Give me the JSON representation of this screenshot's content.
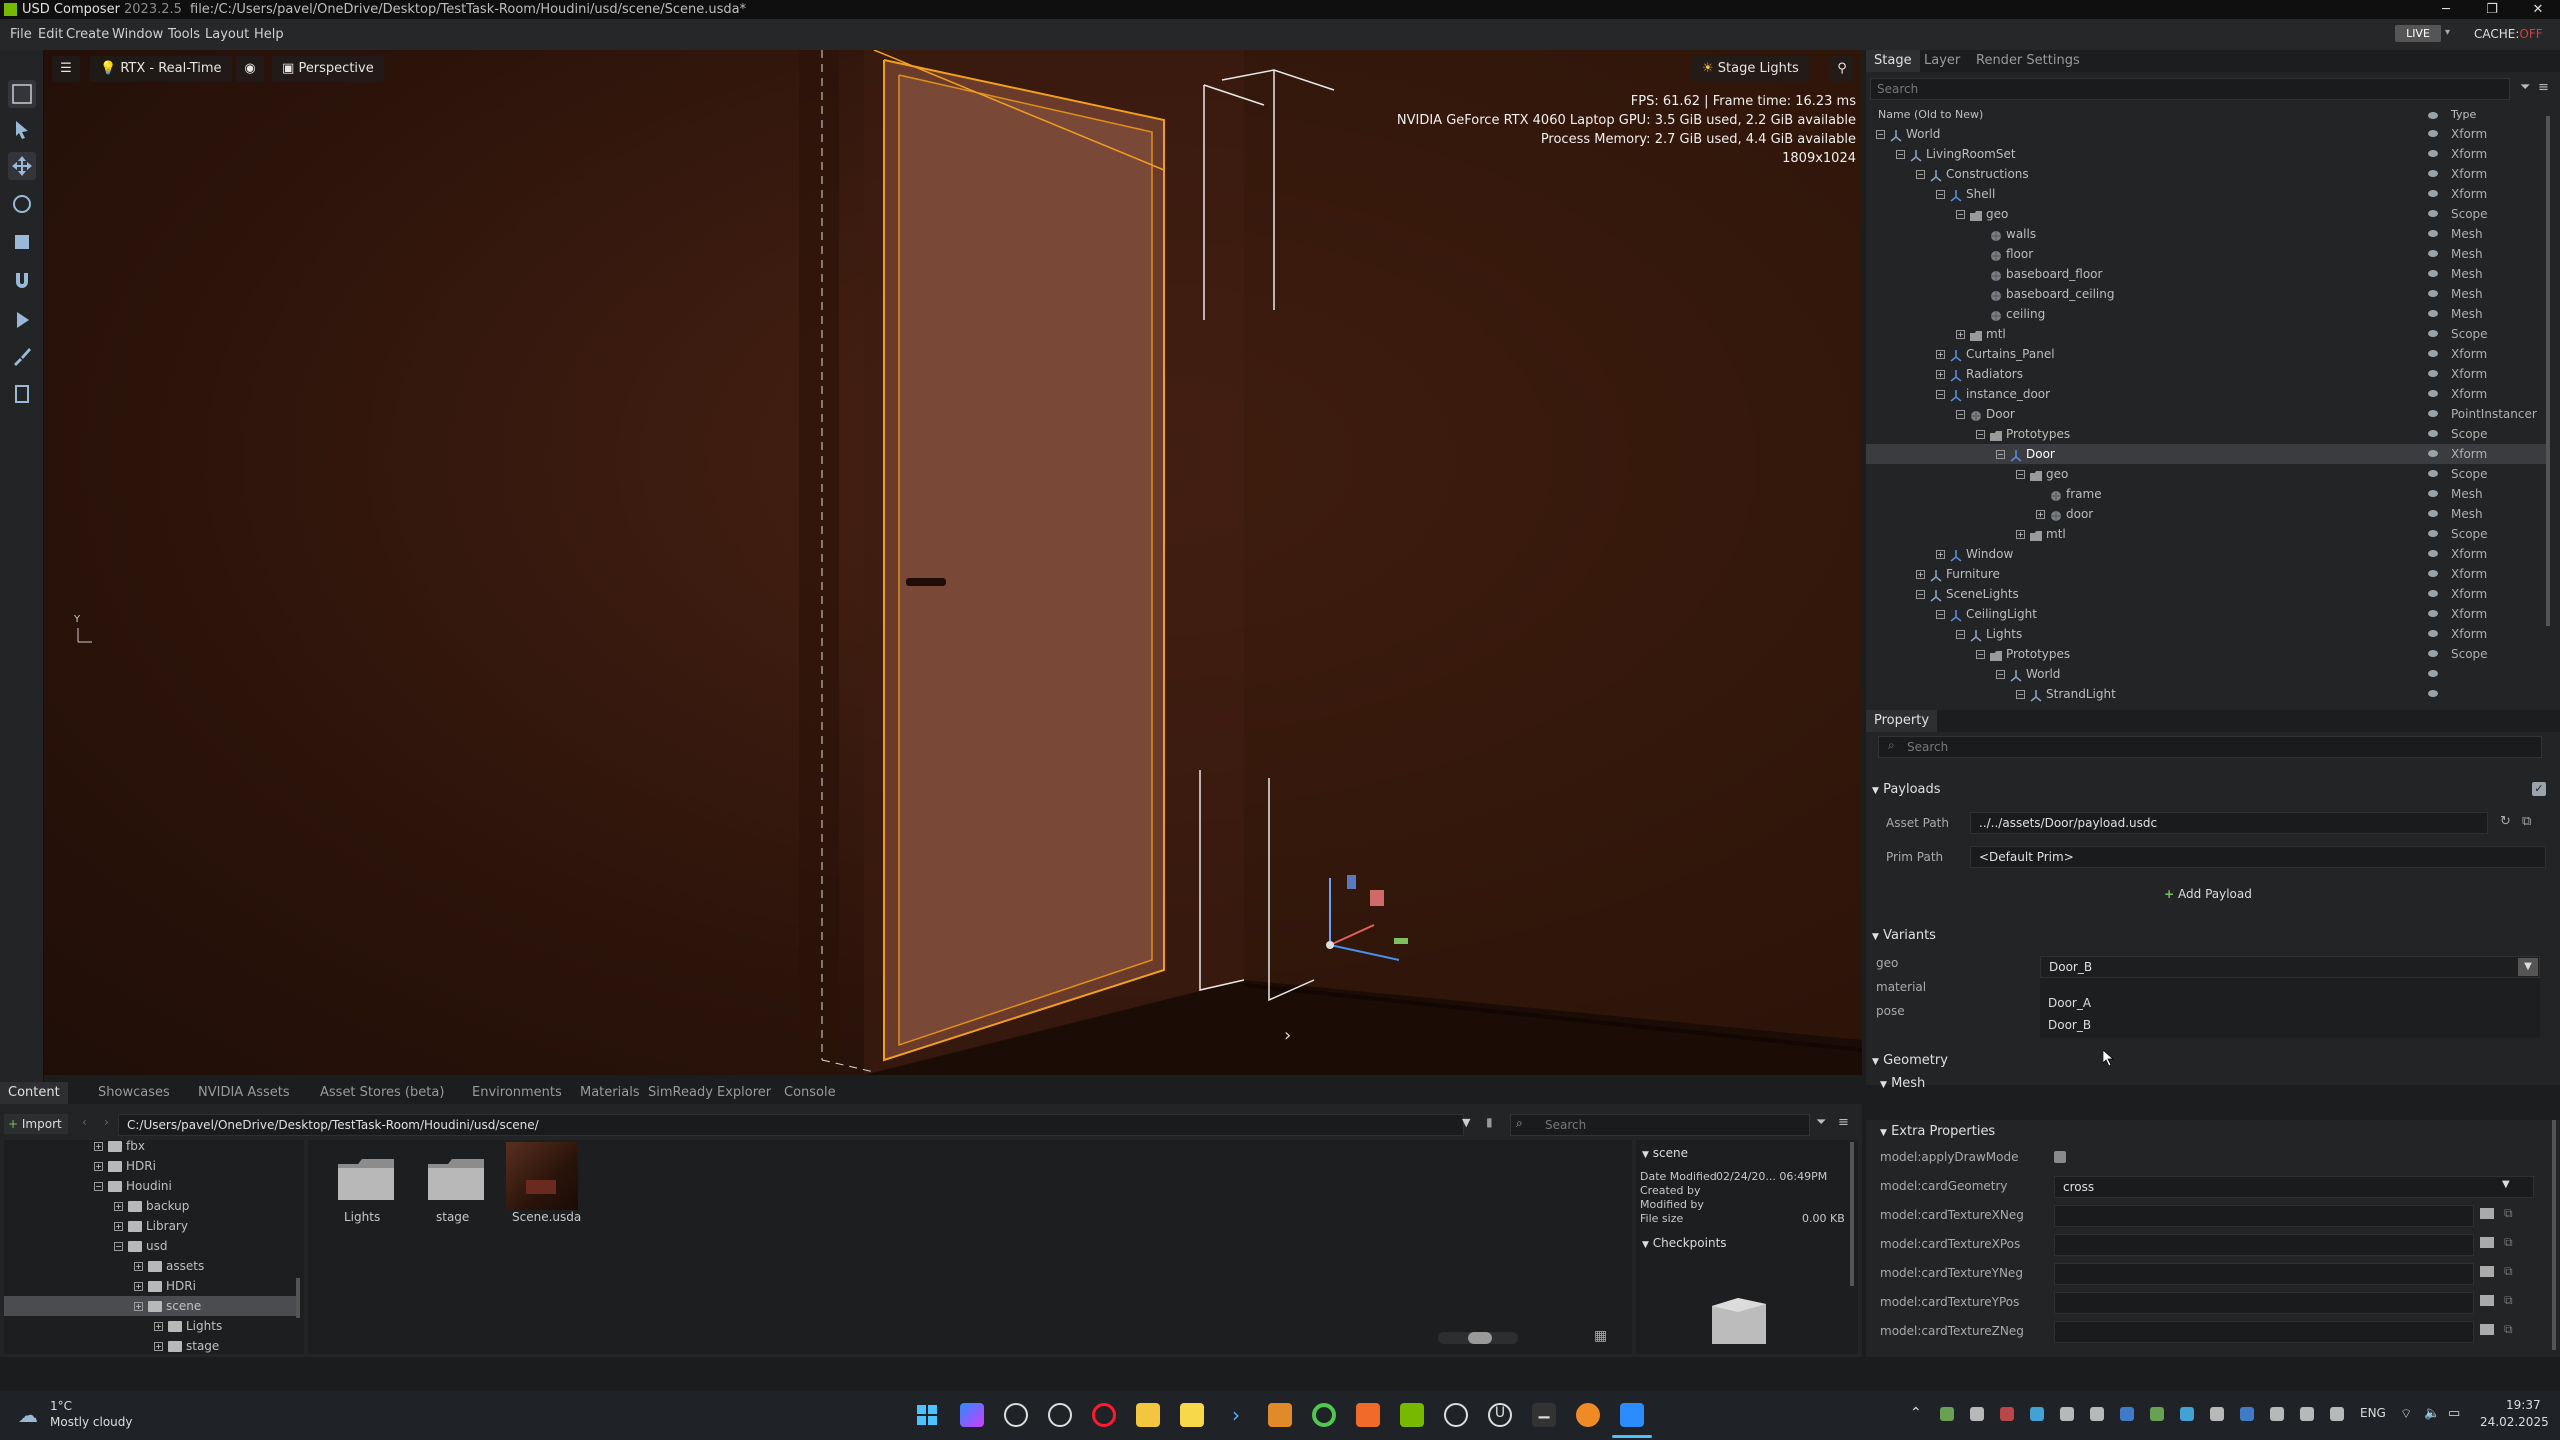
{
  "window": {
    "app_name": "USD Composer",
    "version": "2023.2.5",
    "title": "file:/C:/Users/pavel/OneDrive/Desktop/TestTask-Room/Houdini/usd/scene/Scene.usda*",
    "minimize": "─",
    "maximize": "❐",
    "close": "✕"
  },
  "menu": [
    "File",
    "Edit",
    "Create",
    "Window",
    "Tools",
    "Layout",
    "Help"
  ],
  "menu_right": {
    "live": "LIVE",
    "cache_label": "CACHE:",
    "cache_state": "OFF"
  },
  "viewport": {
    "renderer": "RTX - Real-Time",
    "camera": "Perspective",
    "stage_lights": "Stage Lights",
    "stats": [
      "FPS: 61.62 | Frame time: 16.23 ms",
      "NVIDIA GeForce RTX 4060 Laptop GPU: 3.5 GiB used, 2.2 GiB available",
      "Process Memory: 2.7 GiB used, 4.4 GiB available",
      "1809x1024"
    ],
    "axis_label": "Y"
  },
  "stage": {
    "tabs": [
      "Stage",
      "Layer",
      "Render Settings"
    ],
    "search_placeholder": "Search",
    "col_name": "Name (Old to New)",
    "col_type": "Type",
    "rows": [
      {
        "name": "World",
        "type": "Xform",
        "depth": 0,
        "icon": "xform",
        "exp": "-"
      },
      {
        "name": "LivingRoomSet",
        "type": "Xform",
        "depth": 1,
        "icon": "xform",
        "exp": "-"
      },
      {
        "name": "Constructions",
        "type": "Xform",
        "depth": 2,
        "icon": "xform",
        "exp": "-"
      },
      {
        "name": "Shell",
        "type": "Xform",
        "depth": 3,
        "icon": "xformblue",
        "exp": "-"
      },
      {
        "name": "geo",
        "type": "Scope",
        "depth": 4,
        "icon": "folder",
        "exp": "-"
      },
      {
        "name": "walls",
        "type": "Mesh",
        "depth": 5,
        "icon": "mesh",
        "exp": ""
      },
      {
        "name": "floor",
        "type": "Mesh",
        "depth": 5,
        "icon": "mesh",
        "exp": ""
      },
      {
        "name": "baseboard_floor",
        "type": "Mesh",
        "depth": 5,
        "icon": "mesh",
        "exp": ""
      },
      {
        "name": "baseboard_ceiling",
        "type": "Mesh",
        "depth": 5,
        "icon": "mesh",
        "exp": ""
      },
      {
        "name": "ceiling",
        "type": "Mesh",
        "depth": 5,
        "icon": "mesh",
        "exp": ""
      },
      {
        "name": "mtl",
        "type": "Scope",
        "depth": 4,
        "icon": "folder",
        "exp": "+"
      },
      {
        "name": "Curtains_Panel",
        "type": "Xform",
        "depth": 3,
        "icon": "xformblue",
        "exp": "+"
      },
      {
        "name": "Radiators",
        "type": "Xform",
        "depth": 3,
        "icon": "xformblue",
        "exp": "+"
      },
      {
        "name": "instance_door",
        "type": "Xform",
        "depth": 3,
        "icon": "xformblue",
        "exp": "-"
      },
      {
        "name": "Door",
        "type": "PointInstancer",
        "depth": 4,
        "icon": "mesh",
        "exp": "-"
      },
      {
        "name": "Prototypes",
        "type": "Scope",
        "depth": 5,
        "icon": "folder",
        "exp": "-"
      },
      {
        "name": "Door",
        "type": "Xform",
        "depth": 6,
        "icon": "xformblue",
        "exp": "-",
        "sel": true
      },
      {
        "name": "geo",
        "type": "Scope",
        "depth": 7,
        "icon": "folder",
        "exp": "-"
      },
      {
        "name": "frame",
        "type": "Mesh",
        "depth": 8,
        "icon": "mesh",
        "exp": ""
      },
      {
        "name": "door",
        "type": "Mesh",
        "depth": 8,
        "icon": "mesh",
        "exp": "+"
      },
      {
        "name": "mtl",
        "type": "Scope",
        "depth": 7,
        "icon": "folder",
        "exp": "+"
      },
      {
        "name": "Window",
        "type": "Xform",
        "depth": 3,
        "icon": "xformblue",
        "exp": "+"
      },
      {
        "name": "Furniture",
        "type": "Xform",
        "depth": 2,
        "icon": "xform",
        "exp": "+"
      },
      {
        "name": "SceneLights",
        "type": "Xform",
        "depth": 2,
        "icon": "xform",
        "exp": "-"
      },
      {
        "name": "CeilingLight",
        "type": "Xform",
        "depth": 3,
        "icon": "xformblue",
        "exp": "-"
      },
      {
        "name": "Lights",
        "type": "Xform",
        "depth": 4,
        "icon": "xform",
        "exp": "-"
      },
      {
        "name": "Prototypes",
        "type": "Scope",
        "depth": 5,
        "icon": "folder",
        "exp": "-"
      },
      {
        "name": "World",
        "type": "",
        "depth": 6,
        "icon": "xform",
        "exp": "-"
      },
      {
        "name": "StrandLight",
        "type": "",
        "depth": 7,
        "icon": "xform",
        "exp": "-"
      }
    ]
  },
  "property": {
    "tab": "Property",
    "search_placeholder": "Search",
    "payloads": {
      "title": "Payloads",
      "asset_path_label": "Asset Path",
      "asset_path": "../../assets/Door/payload.usdc",
      "prim_path_label": "Prim Path",
      "prim_path": "<Default Prim>",
      "add_payload": "Add Payload"
    },
    "variants": {
      "title": "Variants",
      "labels": [
        "geo",
        "material",
        "pose"
      ],
      "geo_value": "Door_B",
      "dropdown_options": [
        "Door_A",
        "Door_B"
      ]
    },
    "geometry": {
      "title": "Geometry",
      "mesh": "Mesh",
      "extra": "Extra Properties"
    },
    "extra_props": [
      {
        "label": "model:applyDrawMode",
        "kind": "checkbox"
      },
      {
        "label": "model:cardGeometry",
        "kind": "select",
        "value": "cross"
      },
      {
        "label": "model:cardTextureXNeg",
        "kind": "path"
      },
      {
        "label": "model:cardTextureXPos",
        "kind": "path"
      },
      {
        "label": "model:cardTextureYNeg",
        "kind": "path"
      },
      {
        "label": "model:cardTextureYPos",
        "kind": "path"
      },
      {
        "label": "model:cardTextureZNeg",
        "kind": "path"
      }
    ]
  },
  "content": {
    "tabs": [
      "Content",
      "Showcases",
      "NVIDIA Assets",
      "Asset Stores (beta)",
      "Environments",
      "Materials",
      "SimReady Explorer",
      "Console"
    ],
    "import": "Import",
    "path": "C:/Users/pavel/OneDrive/Desktop/TestTask-Room/Houdini/usd/scene/",
    "search_placeholder": "Search",
    "tree": [
      {
        "name": "fbx",
        "depth": 0
      },
      {
        "name": "HDRi",
        "depth": 0
      },
      {
        "name": "Houdini",
        "depth": 0,
        "exp": "-"
      },
      {
        "name": "backup",
        "depth": 1
      },
      {
        "name": "Library",
        "depth": 1
      },
      {
        "name": "usd",
        "depth": 1,
        "exp": "-"
      },
      {
        "name": "assets",
        "depth": 2
      },
      {
        "name": "HDRi",
        "depth": 2
      },
      {
        "name": "scene",
        "depth": 2,
        "sel": true
      },
      {
        "name": "Lights",
        "depth": 3
      },
      {
        "name": "stage",
        "depth": 3
      }
    ],
    "files": [
      "Lights",
      "stage",
      "Scene.usda"
    ],
    "info": {
      "title": "scene",
      "date_modified_label": "Date Modified",
      "date_modified": "02/24/20... 06:49PM",
      "created_by_label": "Created by",
      "modified_by_label": "Modified by",
      "file_size_label": "File size",
      "file_size": "0.00 KB",
      "checkpoints": "Checkpoints"
    }
  },
  "taskbar": {
    "weather_temp": "1°C",
    "weather_desc": "Mostly cloudy",
    "lang": "ENG",
    "time": "19:37",
    "date": "24.02.2025"
  },
  "colors": {
    "accent_orange": "#f0a020",
    "nvidia_green": "#76b900",
    "selection": "#3a3c3f"
  }
}
